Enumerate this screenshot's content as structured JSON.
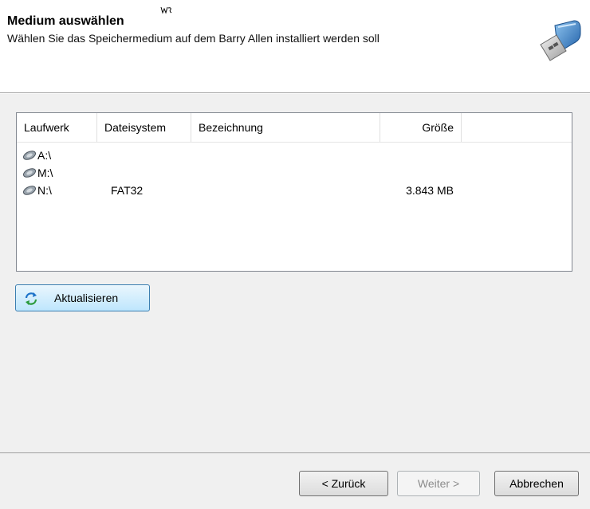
{
  "header": {
    "title": "Medium auswählen",
    "subtitle": "Wählen Sie das Speichermedium auf dem Barry Allen installiert werden soll",
    "icon": "usb-drive-icon"
  },
  "list": {
    "columns": [
      "Laufwerk",
      "Dateisystem",
      "Bezeichnung",
      "Größe"
    ],
    "rows": [
      {
        "drive": "A:\\",
        "fs": "",
        "label": "",
        "size": ""
      },
      {
        "drive": "M:\\",
        "fs": "",
        "label": "",
        "size": ""
      },
      {
        "drive": "N:\\",
        "fs": "FAT32",
        "label": "",
        "size": "3.843 MB"
      }
    ]
  },
  "refresh": {
    "label": "Aktualisieren",
    "icon": "refresh-icon"
  },
  "footer": {
    "back": "< Zurück",
    "next": "Weiter >",
    "cancel": "Abbrechen"
  },
  "colors": {
    "accent_border": "#3c7fb1",
    "content_bg": "#f0f0f0"
  }
}
